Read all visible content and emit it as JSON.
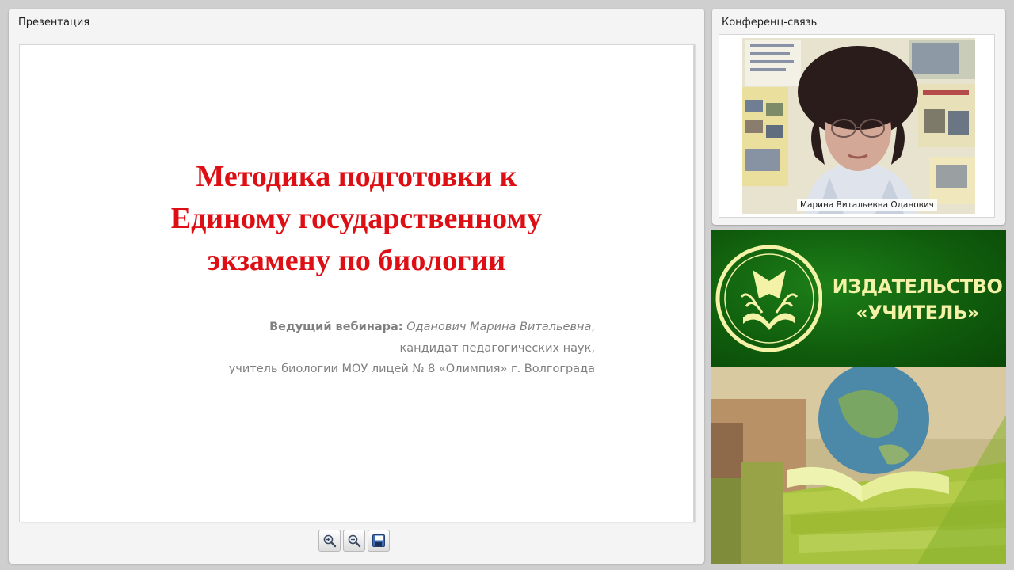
{
  "presentation": {
    "title": "Презентация",
    "slide": {
      "title_lines": [
        "Методика подготовки к",
        "Единому государственному",
        "экзамену по биологии"
      ],
      "host_label": "Ведущий вебинара:",
      "host_name": "Оданович Марина Витальевна",
      "host_comma": ",",
      "degree": "кандидат педагогических наук,",
      "position": "учитель биологии МОУ лицей № 8 «Олимпия» г. Волгограда"
    },
    "toolbar": {
      "zoom_in_icon": "zoom-in-icon",
      "zoom_out_icon": "zoom-out-icon",
      "save_icon": "save-icon"
    }
  },
  "conference": {
    "title": "Конференц-связь",
    "speaker_name": "Марина Витальевна Оданович"
  },
  "ad": {
    "brand_lines": [
      "ИЗДАТЕЛЬСТВО",
      "«УЧИТЕЛЬ»"
    ],
    "colors": {
      "green": "#0f5b0c",
      "text": "#f3f2a6"
    }
  },
  "colors": {
    "slide_title": "#dd0f14",
    "slide_text": "#7f7f7f"
  }
}
